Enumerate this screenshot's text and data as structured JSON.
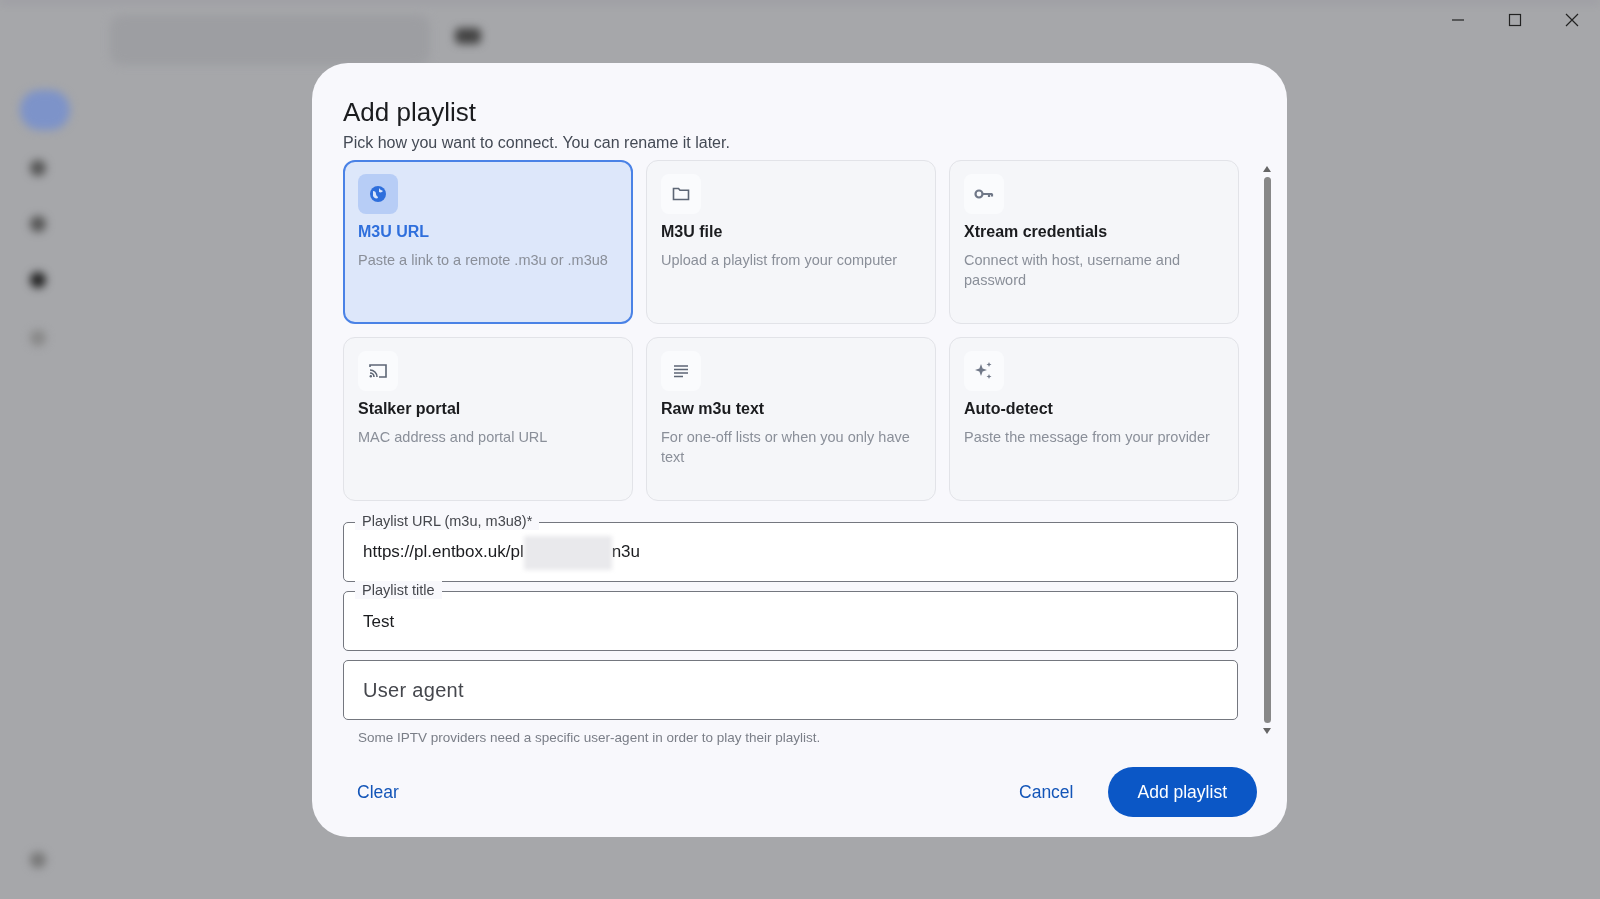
{
  "dialog": {
    "title": "Add playlist",
    "subtitle": "Pick how you want to connect. You can rename it later.",
    "options": [
      {
        "kind": "globe",
        "title": "M3U URL",
        "description": "Paste a link to a remote .m3u or .m3u8",
        "selected": true
      },
      {
        "kind": "folder",
        "title": "M3U file",
        "description": "Upload a playlist from your computer",
        "selected": false
      },
      {
        "kind": "key",
        "title": "Xtream credentials",
        "description": "Connect with host, username and password",
        "selected": false
      },
      {
        "kind": "cast",
        "title": "Stalker portal",
        "description": "MAC address and portal URL",
        "selected": false
      },
      {
        "kind": "lines",
        "title": "Raw m3u text",
        "description": "For one-off lists or when you only have text",
        "selected": false
      },
      {
        "kind": "sparkle",
        "title": "Auto-detect",
        "description": "Paste the message from your provider",
        "selected": false
      }
    ],
    "fields": [
      {
        "label": "Playlist URL (m3u, m3u8)*",
        "value": "https://pl.entbox.uk/pl",
        "value_after_redaction": "n3u"
      },
      {
        "label": "Playlist title",
        "value": "Test"
      },
      {
        "placeholder": "User agent"
      }
    ],
    "hint": "Some IPTV providers need a specific user-agent in order to play their playlist.",
    "buttons": {
      "clear": "Clear",
      "cancel": "Cancel",
      "submit": "Add playlist"
    }
  }
}
